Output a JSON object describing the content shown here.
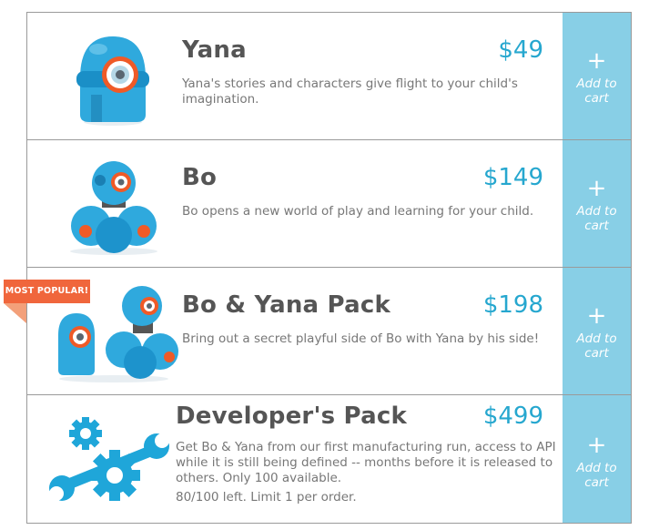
{
  "colors": {
    "accent": "#26a7cf",
    "cart_button": "#88cfe6",
    "badge": "#f0663c",
    "robot_blue": "#2fa9dd",
    "robot_orange": "#ef5a27"
  },
  "badge": {
    "label": "MOST POPULAR!"
  },
  "products": [
    {
      "name": "Yana",
      "price": "$49",
      "description": "Yana's stories and characters give flight to your child's imagination.",
      "cart": {
        "icon": "plus-icon",
        "label": "Add to cart"
      }
    },
    {
      "name": "Bo",
      "price": "$149",
      "description": "Bo opens a new world of play and learning for your child.",
      "cart": {
        "icon": "plus-icon",
        "label": "Add to cart"
      }
    },
    {
      "name": "Bo & Yana Pack",
      "price": "$198",
      "description": "Bring out a secret playful side of Bo with Yana by his side!",
      "cart": {
        "icon": "plus-icon",
        "label": "Add to cart"
      }
    },
    {
      "name": "Developer's Pack",
      "price": "$499",
      "description": "Get Bo & Yana from our first manufacturing run, access to API while it is still being defined -- months before it is released to others. Only 100 available.",
      "limit": "80/100 left. Limit 1 per order.",
      "cart": {
        "icon": "plus-icon",
        "label": "Add to cart"
      }
    }
  ]
}
